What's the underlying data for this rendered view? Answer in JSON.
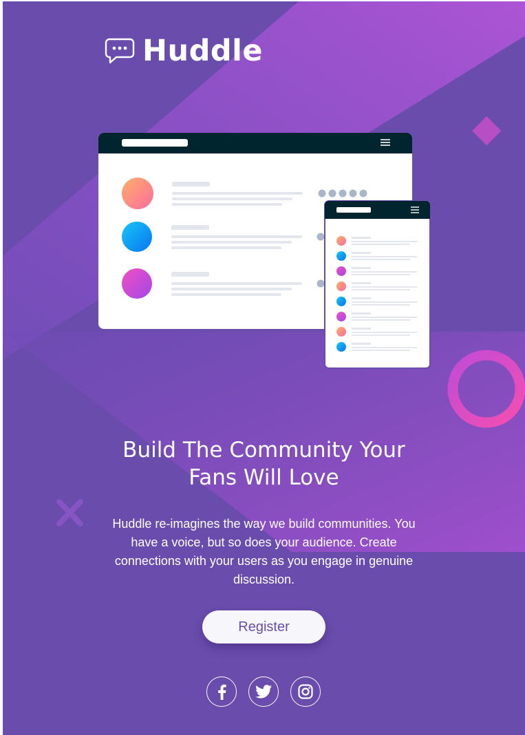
{
  "brand": {
    "name": "Huddle",
    "logo_icon": "chat-bubble-icon"
  },
  "hero": {
    "headline_line1": "Build The Community Your",
    "headline_line2": "Fans Will Love",
    "description": "Huddle re-imagines the way we build communities. You have a voice, but so does your audience. Create connections with your users as you engage in genuine discussion.",
    "register_label": "Register"
  },
  "social": [
    {
      "name": "facebook",
      "icon": "facebook-icon"
    },
    {
      "name": "twitter",
      "icon": "twitter-icon"
    },
    {
      "name": "instagram",
      "icon": "instagram-icon"
    }
  ],
  "colors": {
    "background": "#6a4cad",
    "accent_pink": "#e34dc8",
    "accent_orange": "#f9a27a",
    "accent_blue": "#0aa3f5",
    "dark_bar": "#00252e",
    "button_text": "#6a4cad"
  }
}
